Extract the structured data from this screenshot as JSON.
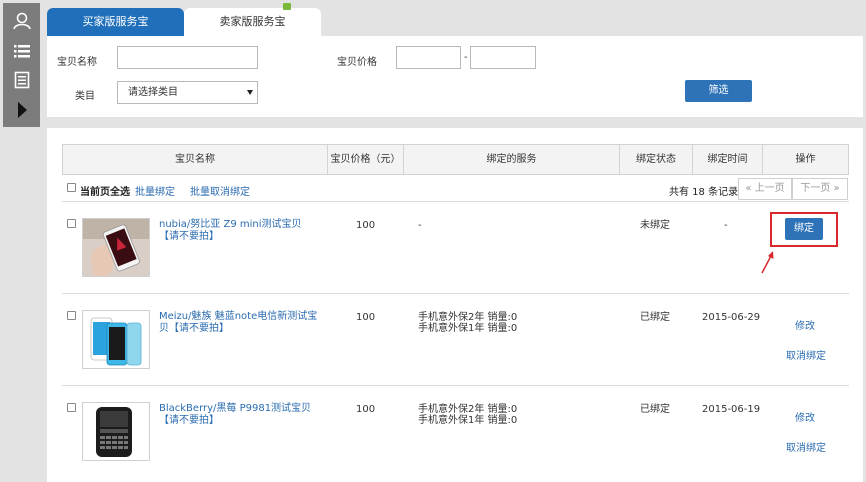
{
  "sidebar": {
    "icons": [
      "user-icon",
      "list-icon",
      "document-icon",
      "play-icon"
    ]
  },
  "tabs": {
    "buyer": "买家版服务宝",
    "seller": "卖家版服务宝"
  },
  "filter": {
    "name_label": "宝贝名称",
    "price_label": "宝贝价格",
    "price_sep": "-",
    "category_label": "类目",
    "category_value": "请选择类目",
    "submit_label": "筛选"
  },
  "table": {
    "headers": [
      "宝贝名称",
      "宝贝价格（元）",
      "绑定的服务",
      "绑定状态",
      "绑定时间",
      "操作"
    ],
    "select_all": "当前页全选",
    "batch_bind": "批量绑定",
    "batch_unbind": "批量取消绑定",
    "record_count": "共有 18 条记录",
    "prev_page": "« 上一页",
    "next_page": "下一页 »",
    "rows": [
      {
        "name": "nubia/努比亚 Z9 mini测试宝贝【请不要拍】",
        "price": "100",
        "services": [
          "-"
        ],
        "status": "未绑定",
        "time": "-",
        "actions": [
          "绑定"
        ]
      },
      {
        "name": "Meizu/魅族 魅蓝note电信新测试宝贝【请不要拍】",
        "price": "100",
        "services": [
          "手机意外保2年 销量:0",
          "手机意外保1年 销量:0"
        ],
        "status": "已绑定",
        "time": "2015-06-29",
        "actions": [
          "修改",
          "取消绑定"
        ]
      },
      {
        "name": "BlackBerry/黑莓 P9981测试宝贝【请不要拍】",
        "price": "100",
        "services": [
          "手机意外保2年 销量:0",
          "手机意外保1年 销量:0"
        ],
        "status": "已绑定",
        "time": "2015-06-19",
        "actions": [
          "修改",
          "取消绑定"
        ]
      }
    ]
  },
  "colors": {
    "accent": "#2e73b8",
    "link": "#2b6cb0",
    "highlight": "#d8282e",
    "sidebar": "#7c7c7c"
  }
}
